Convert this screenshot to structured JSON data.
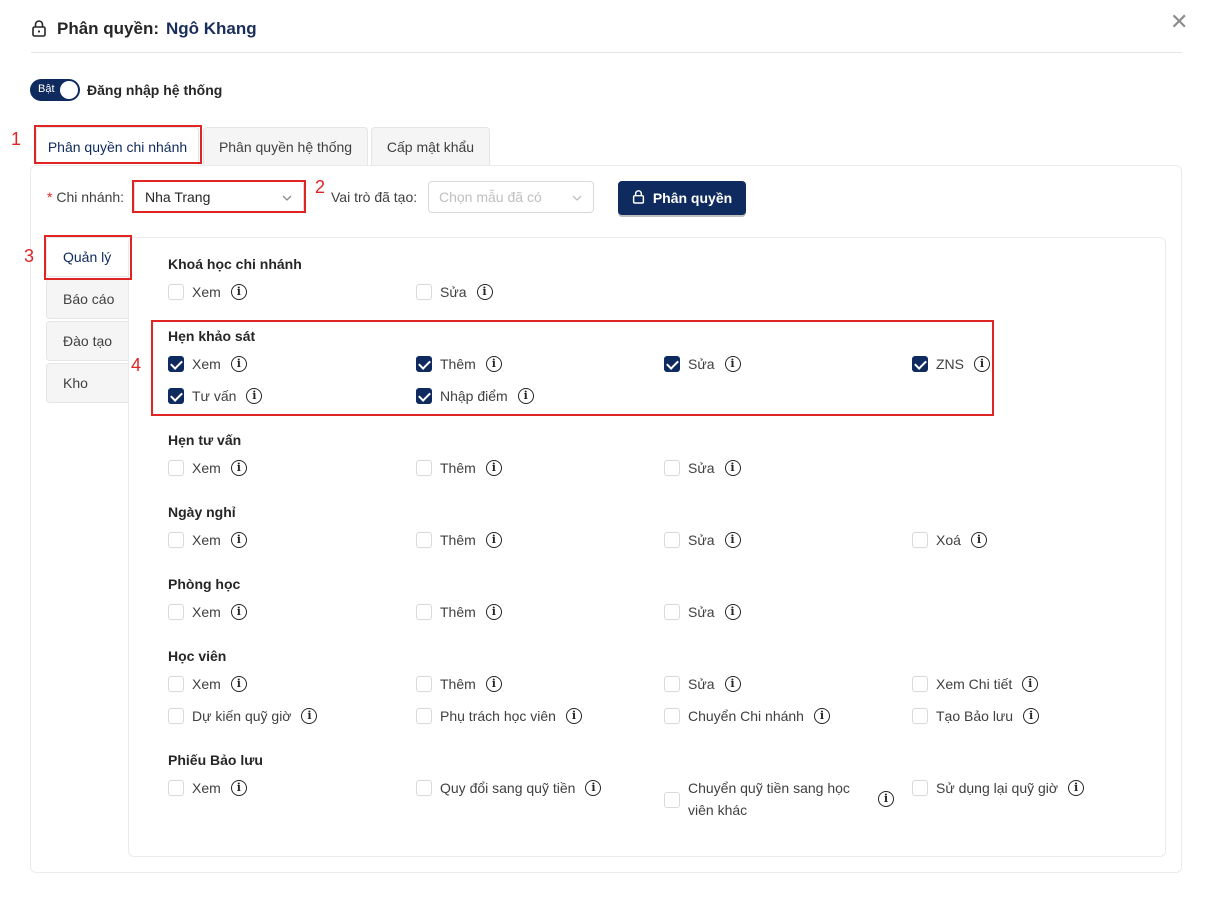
{
  "header": {
    "title_prefix": "Phân quyền:",
    "user_name": "Ngô Khang"
  },
  "toggle": {
    "state_label": "Bật",
    "label": "Đăng nhập hệ thống"
  },
  "tabs": [
    {
      "label": "Phân quyền chi nhánh",
      "active": true
    },
    {
      "label": "Phân quyền hệ thống",
      "active": false
    },
    {
      "label": "Cấp mật khẩu",
      "active": false
    }
  ],
  "form": {
    "branch_label": "Chi nhánh:",
    "branch_required_mark": "*",
    "branch_value": "Nha Trang",
    "role_label": "Vai trò đã tạo:",
    "role_placeholder": "Chọn mẫu đã có",
    "assign_button": "Phân quyền"
  },
  "side_tabs": [
    {
      "label": "Quản lý",
      "active": true
    },
    {
      "label": "Báo cáo",
      "active": false
    },
    {
      "label": "Đào tạo",
      "active": false
    },
    {
      "label": "Kho",
      "active": false
    }
  ],
  "annotations": [
    "1",
    "2",
    "3",
    "4"
  ],
  "groups": [
    {
      "title": "Khoá học chi nhánh",
      "items": [
        {
          "label": "Xem",
          "checked": false
        },
        {
          "label": "Sửa",
          "checked": false
        }
      ]
    },
    {
      "title": "Hẹn khảo sát",
      "items": [
        {
          "label": "Xem",
          "checked": true
        },
        {
          "label": "Thêm",
          "checked": true
        },
        {
          "label": "Sửa",
          "checked": true
        },
        {
          "label": "ZNS",
          "checked": true
        },
        {
          "label": "Tư vấn",
          "checked": true
        },
        {
          "label": "Nhập điểm",
          "checked": true
        }
      ]
    },
    {
      "title": "Hẹn tư vấn",
      "items": [
        {
          "label": "Xem",
          "checked": false
        },
        {
          "label": "Thêm",
          "checked": false
        },
        {
          "label": "Sửa",
          "checked": false
        }
      ]
    },
    {
      "title": "Ngày nghỉ",
      "items": [
        {
          "label": "Xem",
          "checked": false
        },
        {
          "label": "Thêm",
          "checked": false
        },
        {
          "label": "Sửa",
          "checked": false
        },
        {
          "label": "Xoá",
          "checked": false
        }
      ]
    },
    {
      "title": "Phòng học",
      "items": [
        {
          "label": "Xem",
          "checked": false
        },
        {
          "label": "Thêm",
          "checked": false
        },
        {
          "label": "Sửa",
          "checked": false
        }
      ]
    },
    {
      "title": "Học viên",
      "items": [
        {
          "label": "Xem",
          "checked": false
        },
        {
          "label": "Thêm",
          "checked": false
        },
        {
          "label": "Sửa",
          "checked": false
        },
        {
          "label": "Xem Chi tiết",
          "checked": false
        },
        {
          "label": "Dự kiến quỹ giờ",
          "checked": false
        },
        {
          "label": "Phụ trách học viên",
          "checked": false
        },
        {
          "label": "Chuyển Chi nhánh",
          "checked": false
        },
        {
          "label": "Tạo Bảo lưu",
          "checked": false
        }
      ]
    },
    {
      "title": "Phiếu Bảo lưu",
      "items": [
        {
          "label": "Xem",
          "checked": false
        },
        {
          "label": "Quy đổi sang quỹ tiền",
          "checked": false
        },
        {
          "label": "Chuyển quỹ tiền sang học viên khác",
          "checked": false
        },
        {
          "label": "Sử dụng lại quỹ giờ",
          "checked": false
        }
      ]
    }
  ],
  "icons": {
    "lock": "lock-icon",
    "close": "close-icon",
    "info": "info-icon",
    "chevron": "chevron-down-icon"
  },
  "colors": {
    "primary": "#0e2a5e",
    "annotation": "#e02424",
    "border": "#d9d9d9"
  }
}
